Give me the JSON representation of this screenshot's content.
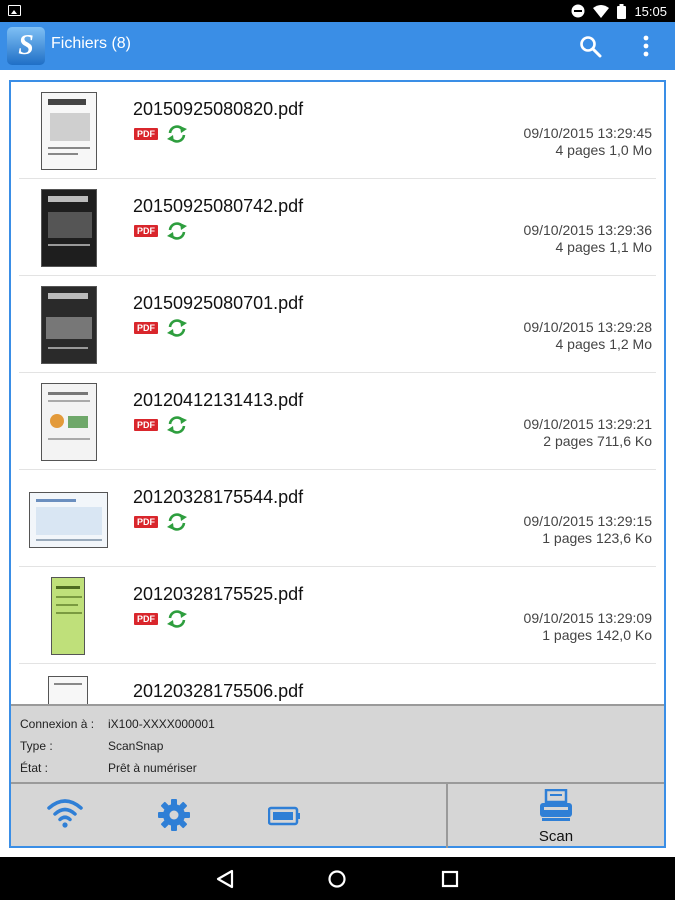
{
  "status_bar": {
    "time": "15:05"
  },
  "app_bar": {
    "title": "Fichiers (8)",
    "logo_letter": "S"
  },
  "files": [
    {
      "name": "20150925080820.pdf",
      "badge": "PDF",
      "date": "09/10/2015 13:29:45",
      "meta": "4 pages 1,0 Mo"
    },
    {
      "name": "20150925080742.pdf",
      "badge": "PDF",
      "date": "09/10/2015 13:29:36",
      "meta": "4 pages 1,1 Mo"
    },
    {
      "name": "20150925080701.pdf",
      "badge": "PDF",
      "date": "09/10/2015 13:29:28",
      "meta": "4 pages 1,2 Mo"
    },
    {
      "name": "20120412131413.pdf",
      "badge": "PDF",
      "date": "09/10/2015 13:29:21",
      "meta": "2 pages 711,6 Ko"
    },
    {
      "name": "20120328175544.pdf",
      "badge": "PDF",
      "date": "09/10/2015 13:29:15",
      "meta": "1 pages 123,6 Ko"
    },
    {
      "name": "20120328175525.pdf",
      "badge": "PDF",
      "date": "09/10/2015 13:29:09",
      "meta": "1 pages 142,0 Ko"
    },
    {
      "name": "20120328175506.pdf"
    }
  ],
  "connection_info": {
    "connection_label": "Connexion à :",
    "connection_value": "iX100-XXXX000001",
    "type_label": "Type :",
    "type_value": "ScanSnap",
    "state_label": "État :",
    "state_value": "Prêt à numériser"
  },
  "toolbar": {
    "scan_label": "Scan"
  },
  "colors": {
    "accent": "#3a8ee6",
    "pdf_badge": "#d9262c",
    "sync": "#2e9e3e"
  }
}
